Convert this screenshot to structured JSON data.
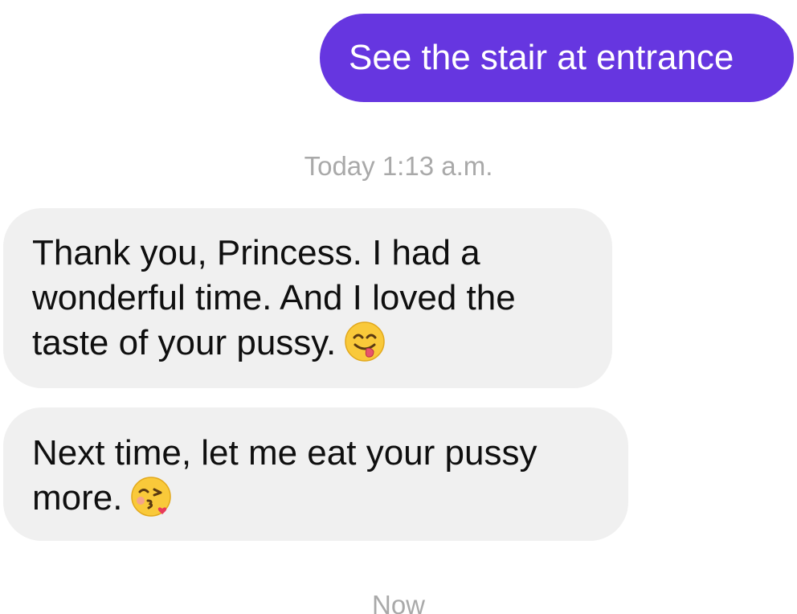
{
  "messages": {
    "outgoing_1": "See the stair at entrance",
    "timestamp_1": "Today 1:13 a.m.",
    "incoming_1": {
      "line_1": "Thank you, Princess. I had a",
      "line_2": "wonderful time. And I loved the",
      "line_3": "taste of your pussy.",
      "emoji": "face-savoring-food-emoji"
    },
    "incoming_2": {
      "line_1": "Next time, let me eat your pussy",
      "line_2": "more.",
      "emoji": "face-blowing-kiss-emoji"
    },
    "timestamp_2": "Now"
  },
  "colors": {
    "outgoing_bubble": "#6636e0",
    "incoming_bubble": "#f0f0f0",
    "timestamp_text": "#a9a9a9"
  }
}
